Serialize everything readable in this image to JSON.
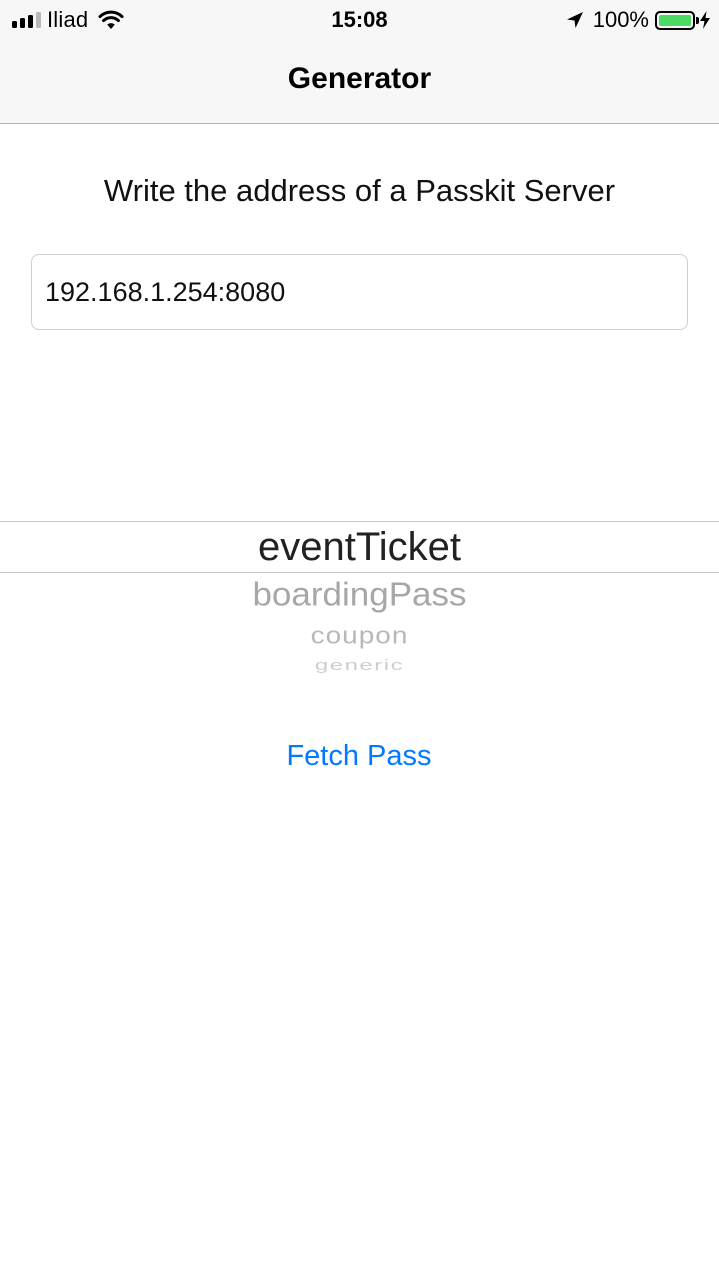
{
  "status_bar": {
    "carrier": "Iliad",
    "time": "15:08",
    "battery_percent": "100%",
    "signal_bars_filled": 3,
    "signal_bars_total": 4,
    "battery_color": "#4cd964",
    "icons": [
      "signal-icon",
      "wifi-icon",
      "location-arrow-icon",
      "battery-icon",
      "charging-bolt-icon"
    ]
  },
  "nav": {
    "title": "Generator"
  },
  "main": {
    "instruction": "Write the address of a Passkit Server",
    "address_input": {
      "value": "192.168.1.254:8080",
      "placeholder": ""
    },
    "pass_type_picker": {
      "selected": "eventTicket",
      "options": [
        "eventTicket",
        "boardingPass",
        "coupon",
        "generic"
      ]
    },
    "fetch_button": {
      "label": "Fetch Pass",
      "color": "#007aff"
    }
  }
}
